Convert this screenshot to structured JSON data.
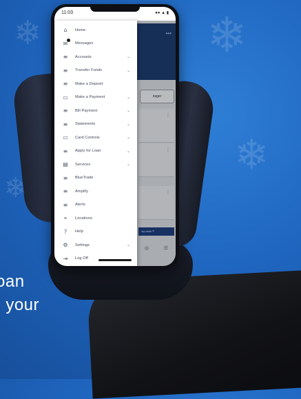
{
  "promo": {
    "line1": "oan",
    "line2": ", your"
  },
  "status_bar": {
    "time": "11:03",
    "system_icons": "●● ▲ ▮"
  },
  "drawer": {
    "items": [
      {
        "label": "Home",
        "icon": "home-icon",
        "glyph": "⌂",
        "chevron": false
      },
      {
        "label": "Messages",
        "icon": "messages-icon",
        "glyph": "✉",
        "chevron": false,
        "badge": true
      },
      {
        "label": "Accounts",
        "icon": "list-icon",
        "glyph": "≡",
        "chevron": true
      },
      {
        "label": "Transfer Funds",
        "icon": "list-icon",
        "glyph": "≡",
        "chevron": true
      },
      {
        "label": "Make a Deposit",
        "icon": "list-icon",
        "glyph": "≡",
        "chevron": false
      },
      {
        "label": "Make a Payment",
        "icon": "card-icon",
        "glyph": "▭",
        "chevron": true
      },
      {
        "label": "Bill Payment",
        "icon": "list-icon",
        "glyph": "≡",
        "chevron": true
      },
      {
        "label": "Statements",
        "icon": "list-icon",
        "glyph": "≡",
        "chevron": true
      },
      {
        "label": "Card Controls",
        "icon": "card-icon",
        "glyph": "▭",
        "chevron": true
      },
      {
        "label": "Apply for Loan",
        "icon": "list-icon",
        "glyph": "≡",
        "chevron": true
      },
      {
        "label": "Services",
        "icon": "calendar-icon",
        "glyph": "▤",
        "chevron": true
      },
      {
        "label": "BlueTrade",
        "icon": "list-icon",
        "glyph": "≡",
        "chevron": false
      },
      {
        "label": "Amplify",
        "icon": "list-icon",
        "glyph": "≡",
        "chevron": false
      },
      {
        "label": "Alerts",
        "icon": "list-icon",
        "glyph": "≡",
        "chevron": false
      },
      {
        "label": "Locations",
        "icon": "location-pin-icon",
        "glyph": "⌖",
        "chevron": false
      },
      {
        "label": "Help",
        "icon": "help-icon",
        "glyph": "?",
        "chevron": false
      },
      {
        "label": "Settings",
        "icon": "gear-icon",
        "glyph": "⚙",
        "chevron": true
      },
      {
        "label": "Log Off",
        "icon": "logout-icon",
        "glyph": "⇥",
        "chevron": false
      }
    ],
    "chevron_glyph": "⌄"
  },
  "app_behind": {
    "header_dots": "•••",
    "button_label": "nager",
    "card_dots": "⋮",
    "banner_text": "nly-bank™",
    "nav_glyphs": [
      "◎",
      "☰"
    ]
  },
  "colors": {
    "background_blue": "#1f66c0",
    "drawer_bg": "#ffffff",
    "header_navy": "#1b3a6b"
  }
}
